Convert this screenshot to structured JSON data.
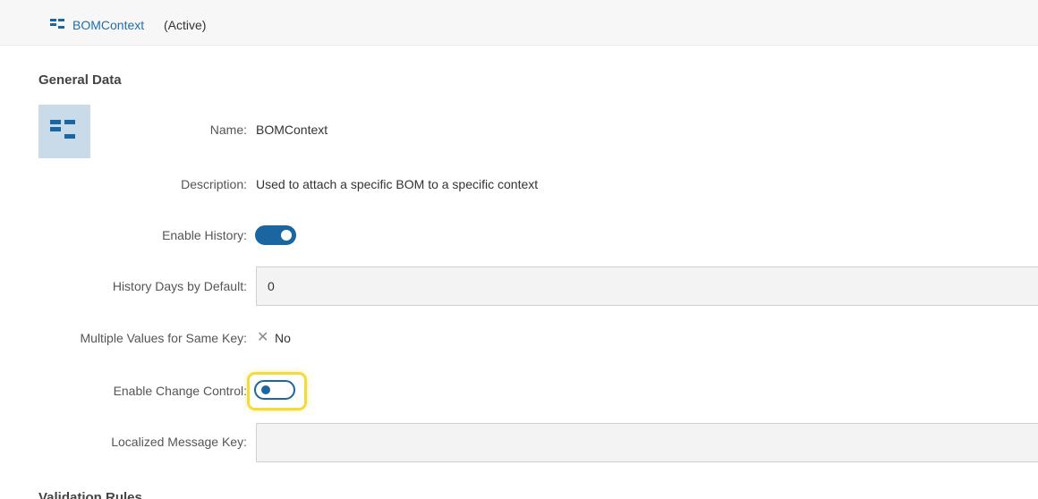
{
  "header": {
    "icon": "bom-context-icon",
    "title": "BOMContext",
    "status": "(Active)"
  },
  "general": {
    "section_title": "General Data",
    "type_icon": "data-container-type-icon",
    "name_label": "Name:",
    "name_value": "BOMContext",
    "description_label": "Description:",
    "description_value": "Used to attach a specific BOM to a specific context",
    "enable_history_label": "Enable History:",
    "enable_history_on": true,
    "history_days_label": "History Days by Default:",
    "history_days_value": "0",
    "multiple_values_label": "Multiple Values for Same Key:",
    "multiple_values_icon": "x-icon",
    "multiple_values_value": "No",
    "change_control_label": "Enable Change Control:",
    "change_control_on": false,
    "localized_key_label": "Localized Message Key:",
    "localized_key_value": ""
  },
  "validation": {
    "section_title": "Validation Rules"
  },
  "colors": {
    "accent": "#1b66a0",
    "link": "#1f6fa8",
    "highlight": "#f2dc3c",
    "icon_box": "#c9dbe8"
  }
}
